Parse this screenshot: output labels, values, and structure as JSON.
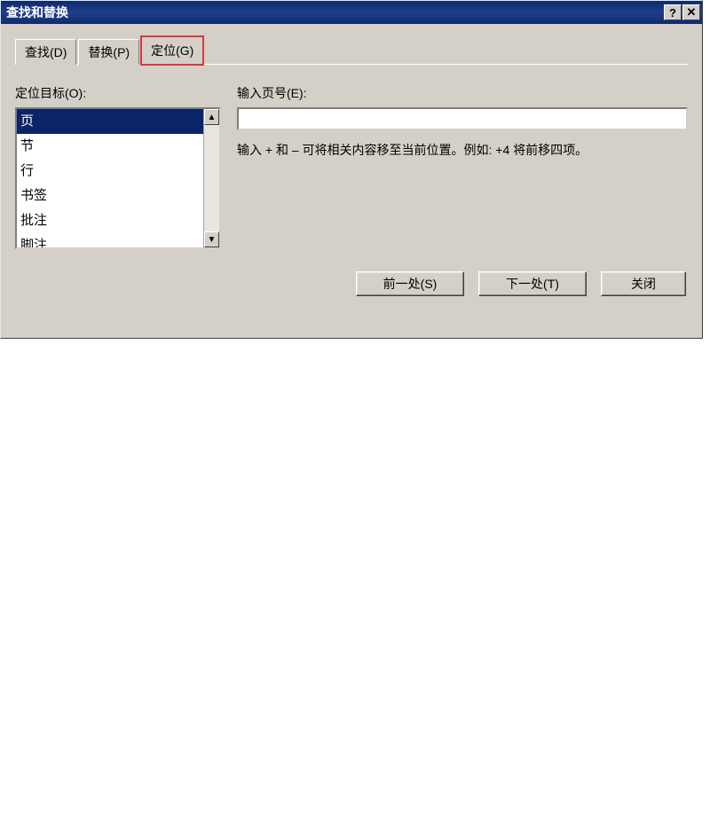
{
  "window": {
    "title": "查找和替换"
  },
  "tabs": {
    "find": "查找(D)",
    "replace": "替换(P)",
    "goto": "定位(G)"
  },
  "labels": {
    "goto_target": "定位目标(O):",
    "input_page": "输入页号(E):"
  },
  "list": {
    "items": [
      "页",
      "节",
      "行",
      "书签",
      "批注",
      "脚注"
    ],
    "selected_index": 0
  },
  "input": {
    "value": ""
  },
  "hint": "输入 + 和 – 可将相关内容移至当前位置。例如: +4 将前移四项。",
  "buttons": {
    "prev": "前一处(S)",
    "next": "下一处(T)",
    "close": "关闭"
  }
}
